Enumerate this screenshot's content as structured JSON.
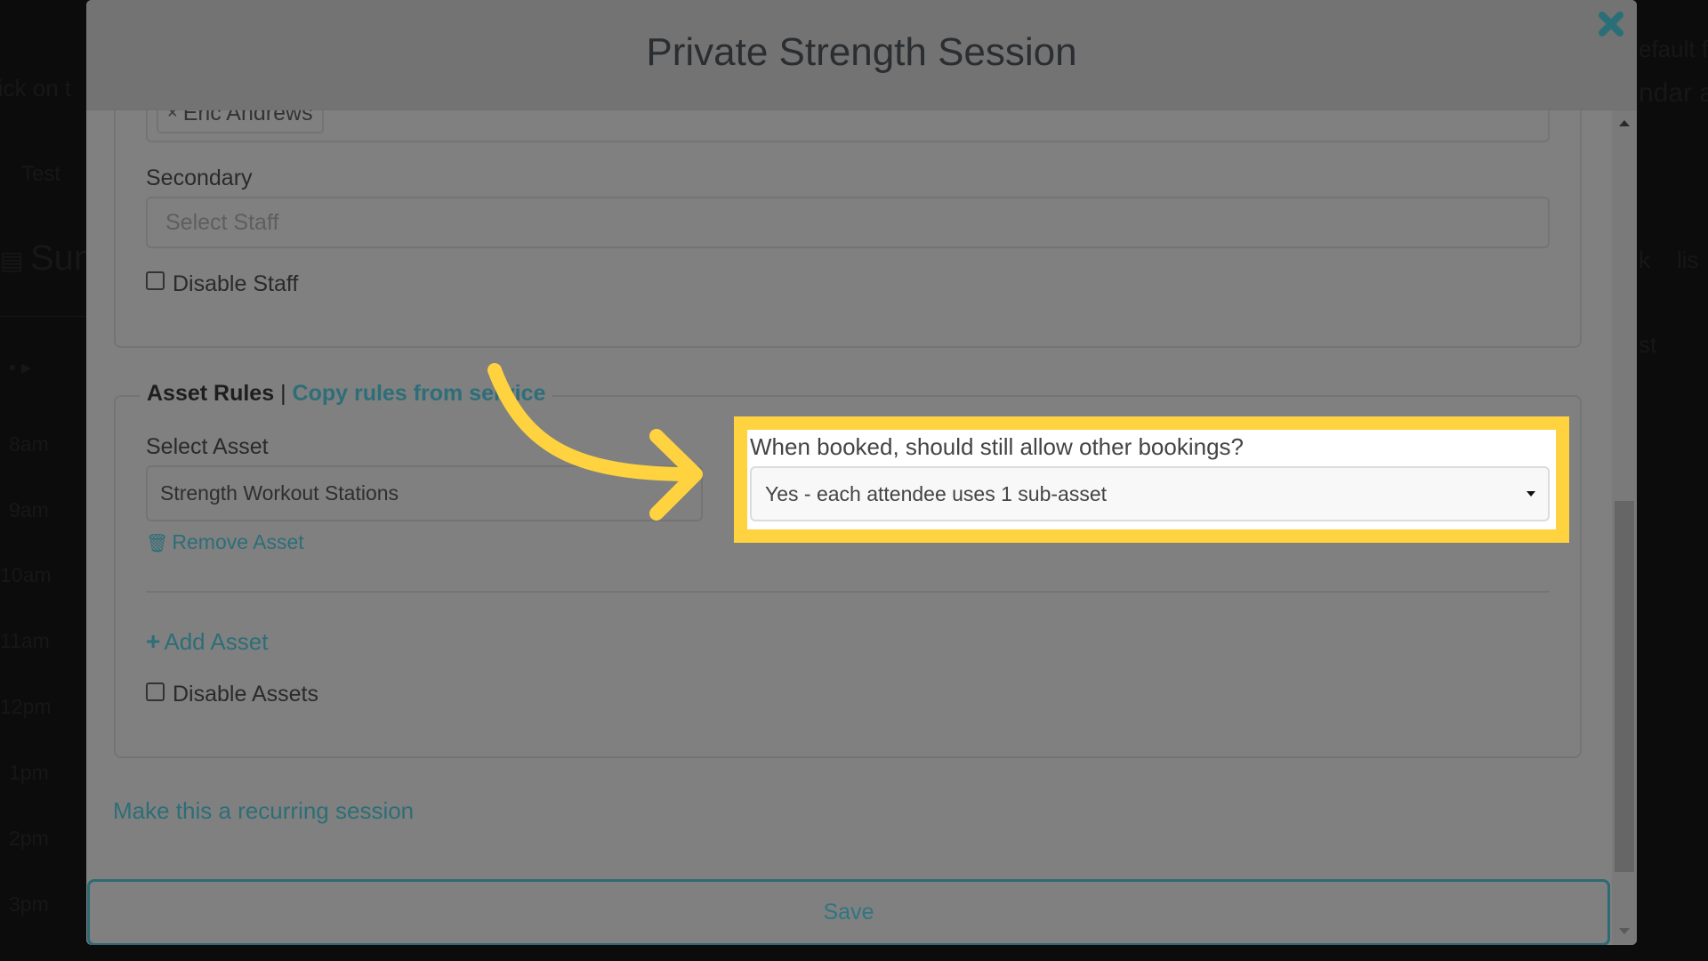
{
  "background": {
    "texts": [
      {
        "id": "bg-click-hint",
        "text": "lick on t"
      },
      {
        "id": "bg-test",
        "text": "Test"
      },
      {
        "id": "bg-sun",
        "text": "Sun"
      },
      {
        "id": "bg-default-filter",
        "text": "efault fil"
      },
      {
        "id": "bg-calendar",
        "text": "ndar a"
      },
      {
        "id": "bg-list",
        "text": "lis"
      },
      {
        "id": "bg-k",
        "text": "k"
      },
      {
        "id": "bg-st",
        "text": "st"
      }
    ],
    "times": [
      "8am",
      "9am",
      "10am",
      "11am",
      "12pm",
      "1pm",
      "2pm",
      "3pm"
    ]
  },
  "modal": {
    "title": "Private Strength Session",
    "close_icon": "close-x-icon",
    "staff": {
      "primary_tag": "Eric Andrews",
      "tag_remove_glyph": "×",
      "secondary_label": "Secondary",
      "secondary_placeholder": "Select Staff",
      "disable_staff_label": "Disable Staff",
      "disable_staff_checked": false
    },
    "assets": {
      "legend_title": "Asset Rules",
      "legend_separator": "|",
      "copy_rules_link": "Copy rules from service",
      "select_asset_label": "Select Asset",
      "selected_asset": "Strength Workout Stations",
      "remove_asset_link": "Remove Asset",
      "booking_question": "When booked, should still allow other bookings?",
      "booking_option_selected": "Yes - each attendee uses 1 sub-asset",
      "add_asset_link": "Add Asset",
      "disable_assets_label": "Disable Assets",
      "disable_assets_checked": false
    },
    "recurring_link": "Make this a recurring session",
    "save_label": "Save"
  },
  "annotation": {
    "highlight_color": "#ffd23f",
    "arrow_color": "#ffd23f"
  },
  "colors": {
    "link": "#2d6e78",
    "overlay_header": "#737373",
    "overlay_body": "#808080"
  }
}
